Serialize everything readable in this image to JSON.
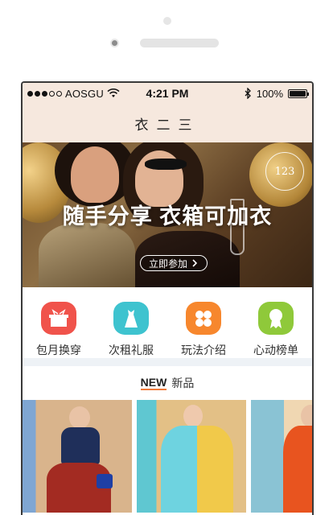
{
  "status_bar": {
    "carrier": "AOSGU",
    "time": "4:21 PM",
    "battery_percent": "100%",
    "battery_level": 1.0
  },
  "header": {
    "brand": "衣二三"
  },
  "banner": {
    "headline": "随手分享 衣箱可加衣",
    "cta_label": "立即参加",
    "logo_text": "123"
  },
  "quick_menu": [
    {
      "label": "包月换穿",
      "icon": "gift-box-icon",
      "color": "#f0534b"
    },
    {
      "label": "次租礼服",
      "icon": "dress-icon",
      "color": "#3ec3cf"
    },
    {
      "label": "玩法介绍",
      "icon": "four-petal-icon",
      "color": "#f7872d"
    },
    {
      "label": "心动榜单",
      "icon": "rosette-icon",
      "color": "#8fc93a"
    }
  ],
  "new_section": {
    "tag": "NEW",
    "title": "新品"
  },
  "colors": {
    "header_bg": "#f6e8de",
    "accent": "#f07a3a",
    "strip": "#eef2f6"
  }
}
